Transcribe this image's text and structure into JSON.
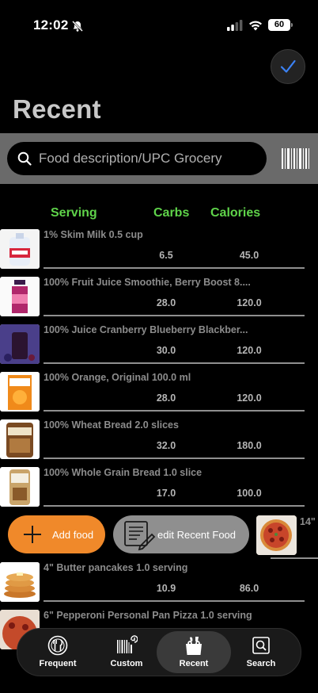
{
  "status_bar": {
    "time": "12:02",
    "battery": "60"
  },
  "header": {
    "title": "Recent"
  },
  "search": {
    "placeholder": "Food description/UPC Grocery"
  },
  "columns": {
    "serving": "Serving",
    "carbs": "Carbs",
    "calories": "Calories"
  },
  "foods": [
    {
      "name": "1% Skim Milk 0.5 cup",
      "carbs": "6.5",
      "calories": "45.0",
      "thumb": "milk-jug"
    },
    {
      "name": "100% Fruit Juice Smoothie, Berry Boost 8....",
      "carbs": "28.0",
      "calories": "120.0",
      "thumb": "juice-bottle"
    },
    {
      "name": "100% Juice Cranberry Blueberry Blackber...",
      "carbs": "30.0",
      "calories": "120.0",
      "thumb": "juice-glass"
    },
    {
      "name": "100% Orange, Original 100.0 ml",
      "carbs": "28.0",
      "calories": "120.0",
      "thumb": "orange-juice-carton"
    },
    {
      "name": "100% Wheat Bread 2.0 slices",
      "carbs": "32.0",
      "calories": "180.0",
      "thumb": "wheat-bread-bag"
    },
    {
      "name": "100% Whole Grain Bread 1.0 slice",
      "carbs": "17.0",
      "calories": "100.0",
      "thumb": "grain-bread-bag"
    },
    {
      "name": "4\" Butter pancakes 1.0 serving",
      "carbs": "10.9",
      "calories": "86.0",
      "thumb": "pancake-stack"
    },
    {
      "name": "6\" Pepperoni Personal Pan Pizza 1.0 serving",
      "carbs": "",
      "calories": "",
      "thumb": "pizza"
    }
  ],
  "actions": {
    "add_food": "Add food",
    "edit_recent": "edit Recent Food",
    "side_item_label": "14\""
  },
  "tabs": [
    {
      "label": "Frequent",
      "icon": "plate-utensils-icon"
    },
    {
      "label": "Custom",
      "icon": "barcode-refresh-icon"
    },
    {
      "label": "Recent",
      "icon": "grocery-bag-icon",
      "active": true
    },
    {
      "label": "Search",
      "icon": "magnifier-box-icon"
    }
  ],
  "colors": {
    "accent_green": "#5fd34a",
    "add_orange": "#f0892a",
    "check_blue": "#3b82f6"
  }
}
